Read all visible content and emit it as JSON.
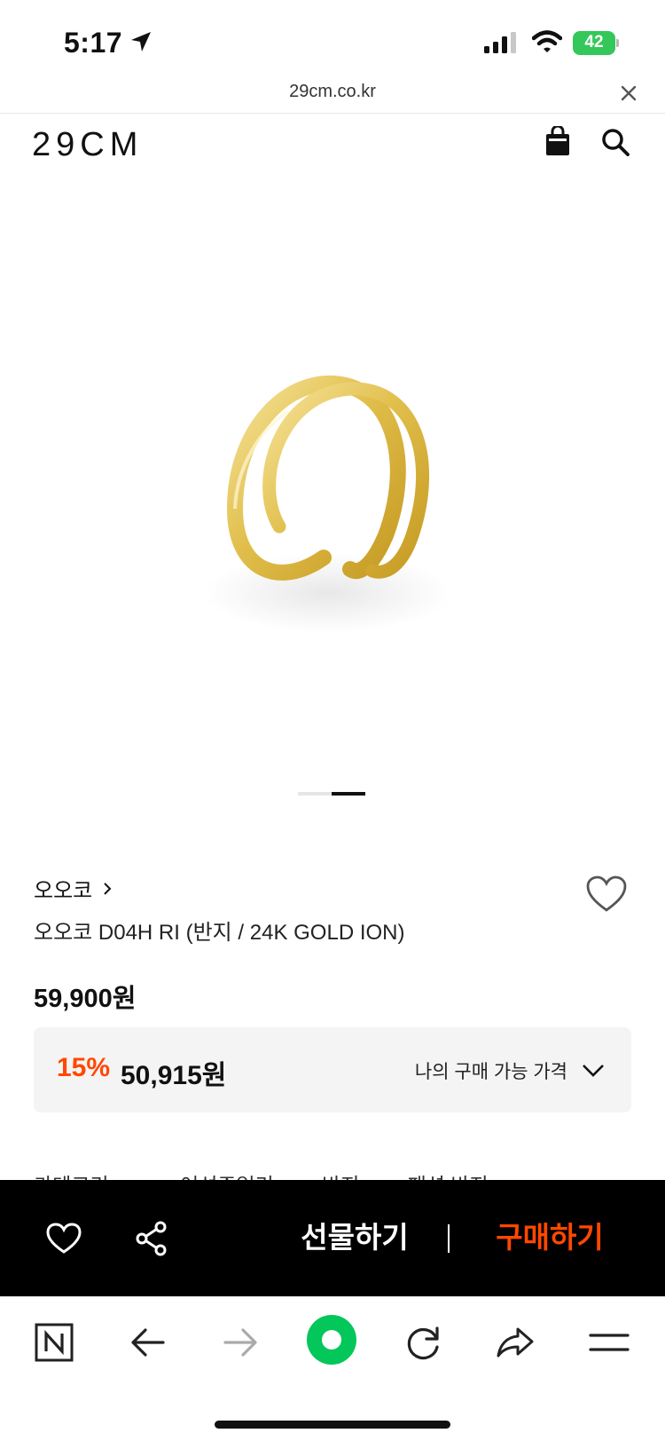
{
  "status_bar": {
    "time": "5:17",
    "battery": "42"
  },
  "url_bar": {
    "domain": "29cm.co.kr"
  },
  "header": {
    "logo": "29CM"
  },
  "product": {
    "brand": "오오코",
    "title": "오오코 D04H RI (반지 / 24K GOLD ION)",
    "price_original": "59,900원",
    "discount_rate": "15%",
    "discount_price": "50,915원",
    "my_price_label": "나의 구매 가능 가격"
  },
  "category": {
    "label": "카테고리",
    "path": [
      "여성주얼리",
      "반지",
      "패션 반지"
    ],
    "separator": ">"
  },
  "action_bar": {
    "gift_label": "선물하기",
    "buy_label": "구매하기"
  },
  "colors": {
    "accent": "#ff4800",
    "battery": "#34c759",
    "naver_green": "#03c75a",
    "ring_gold": "#e3c25a"
  },
  "icons": [
    "location-arrow-icon",
    "cellular-signal-icon",
    "wifi-icon",
    "battery-icon",
    "close-icon",
    "shopping-bag-icon",
    "search-icon",
    "heart-icon",
    "chevron-right-icon",
    "chevron-down-icon",
    "share-icon",
    "naver-n-icon",
    "back-arrow-icon",
    "forward-arrow-icon",
    "naver-green-dot-icon",
    "refresh-icon",
    "send-icon",
    "menu-icon"
  ]
}
